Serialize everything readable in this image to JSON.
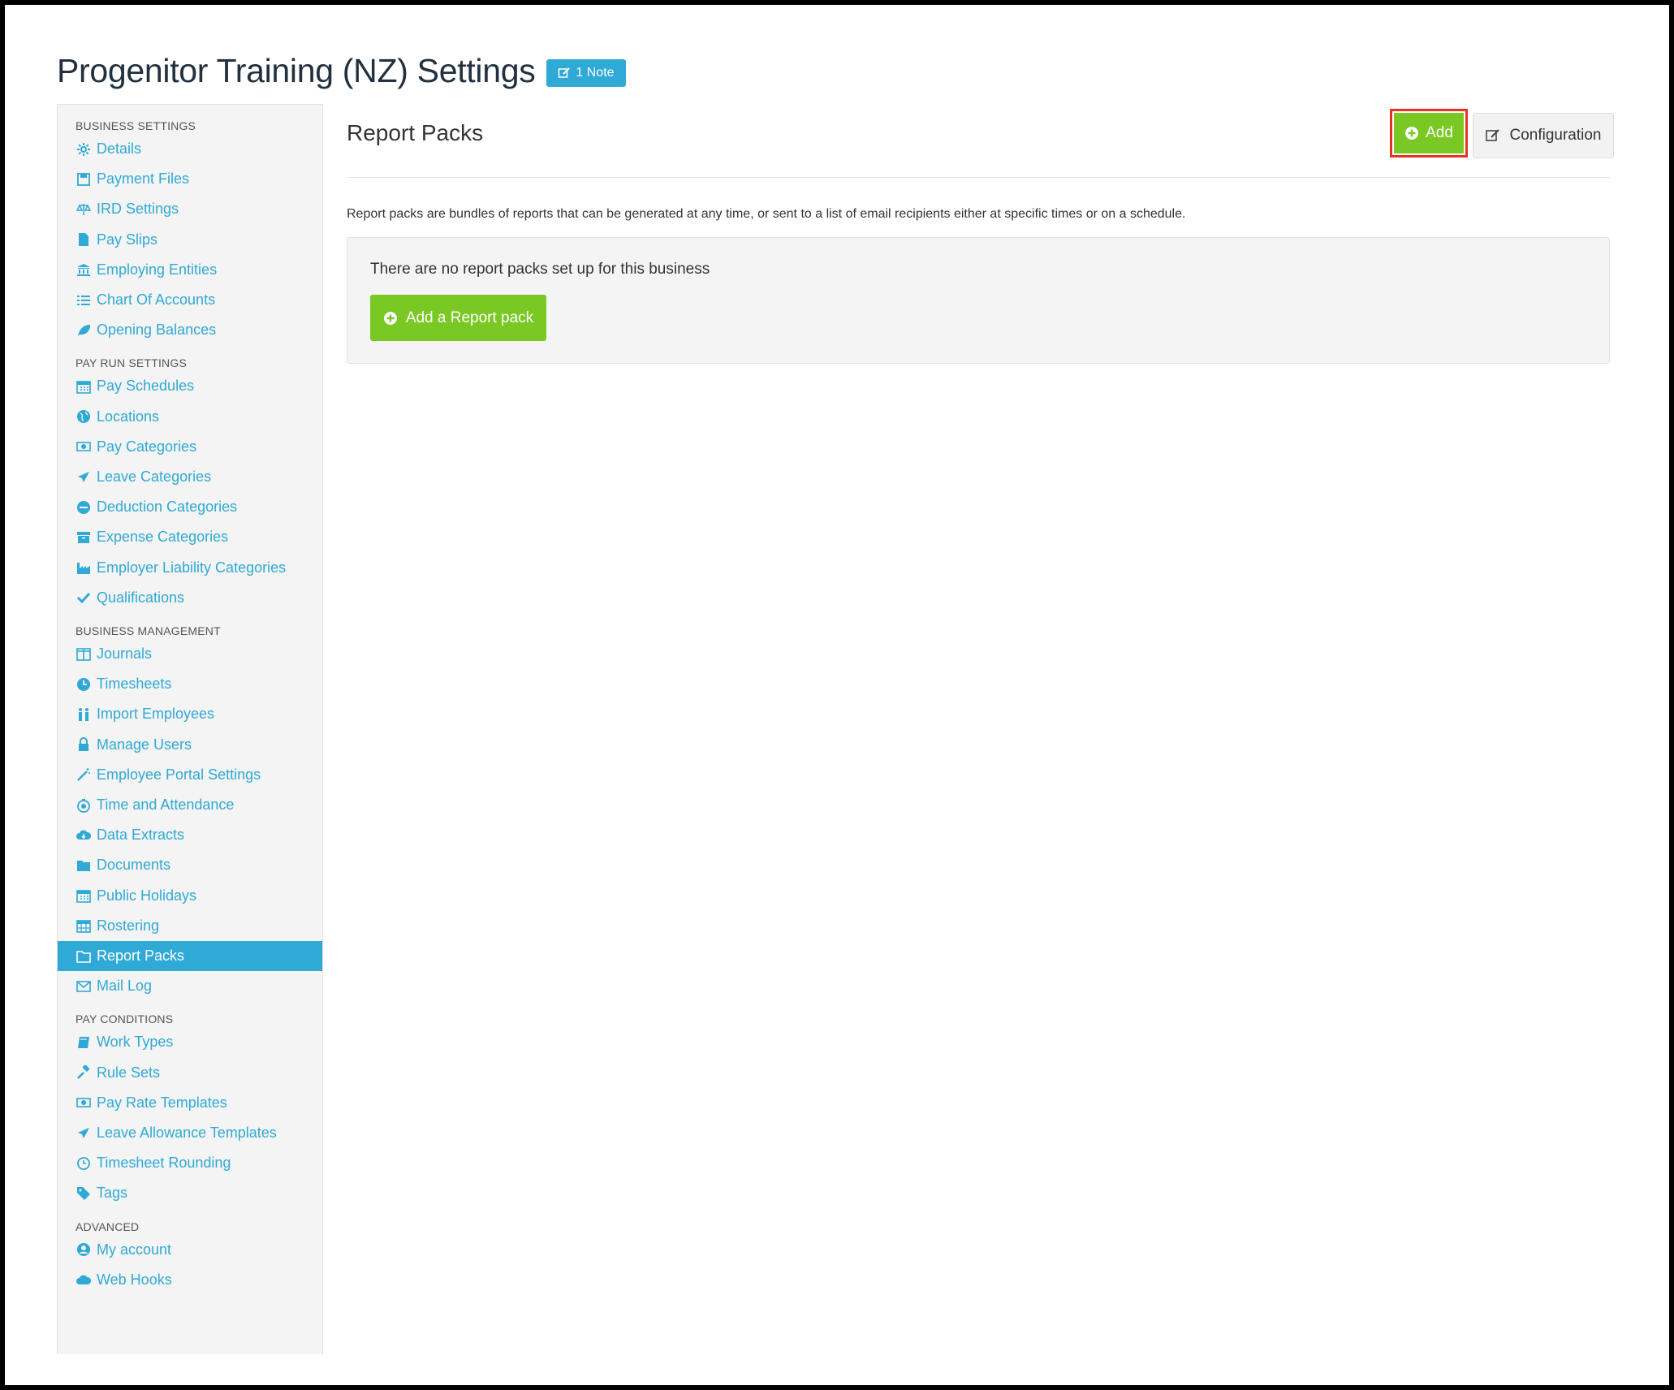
{
  "header": {
    "title": "Progenitor Training (NZ) Settings",
    "note_badge": "1 Note"
  },
  "sidebar": {
    "sections": [
      {
        "title": "BUSINESS SETTINGS",
        "items": [
          {
            "label": "Details",
            "icon": "gear-icon"
          },
          {
            "label": "Payment Files",
            "icon": "floppy-icon"
          },
          {
            "label": "IRD Settings",
            "icon": "scale-icon"
          },
          {
            "label": "Pay Slips",
            "icon": "file-icon"
          },
          {
            "label": "Employing Entities",
            "icon": "bank-icon"
          },
          {
            "label": "Chart Of Accounts",
            "icon": "list-icon"
          },
          {
            "label": "Opening Balances",
            "icon": "leaf-icon"
          }
        ]
      },
      {
        "title": "PAY RUN SETTINGS",
        "items": [
          {
            "label": "Pay Schedules",
            "icon": "calendar-icon"
          },
          {
            "label": "Locations",
            "icon": "globe-icon"
          },
          {
            "label": "Pay Categories",
            "icon": "money-icon"
          },
          {
            "label": "Leave Categories",
            "icon": "plane-icon"
          },
          {
            "label": "Deduction Categories",
            "icon": "minus-circle-icon"
          },
          {
            "label": "Expense Categories",
            "icon": "archive-icon"
          },
          {
            "label": "Employer Liability Categories",
            "icon": "industry-icon"
          },
          {
            "label": "Qualifications",
            "icon": "check-icon"
          }
        ]
      },
      {
        "title": "BUSINESS MANAGEMENT",
        "items": [
          {
            "label": "Journals",
            "icon": "columns-icon"
          },
          {
            "label": "Timesheets",
            "icon": "clock-icon"
          },
          {
            "label": "Import Employees",
            "icon": "users-icon"
          },
          {
            "label": "Manage Users",
            "icon": "lock-icon"
          },
          {
            "label": "Employee Portal Settings",
            "icon": "magic-wand-icon"
          },
          {
            "label": "Time and Attendance",
            "icon": "stopwatch-icon"
          },
          {
            "label": "Data Extracts",
            "icon": "cloud-download-icon"
          },
          {
            "label": "Documents",
            "icon": "folder-icon"
          },
          {
            "label": "Public Holidays",
            "icon": "calendar-icon"
          },
          {
            "label": "Rostering",
            "icon": "calendar-grid-icon"
          },
          {
            "label": "Report Packs",
            "icon": "folder-open-icon",
            "active": true
          },
          {
            "label": "Mail Log",
            "icon": "envelope-icon"
          }
        ]
      },
      {
        "title": "PAY CONDITIONS",
        "items": [
          {
            "label": "Work Types",
            "icon": "book-icon"
          },
          {
            "label": "Rule Sets",
            "icon": "gavel-icon"
          },
          {
            "label": "Pay Rate Templates",
            "icon": "money-icon"
          },
          {
            "label": "Leave Allowance Templates",
            "icon": "plane-icon"
          },
          {
            "label": "Timesheet Rounding",
            "icon": "clock-outline-icon"
          },
          {
            "label": "Tags",
            "icon": "tag-icon"
          }
        ]
      },
      {
        "title": "ADVANCED",
        "items": [
          {
            "label": "My account",
            "icon": "user-circle-icon"
          },
          {
            "label": "Web Hooks",
            "icon": "cloud-icon"
          }
        ]
      }
    ]
  },
  "main": {
    "title": "Report Packs",
    "add_label": "Add",
    "configuration_label": "Configuration",
    "description": "Report packs are bundles of reports that can be generated at any time, or sent to a list of email recipients either at specific times or on a schedule.",
    "empty_message": "There are no report packs set up for this business",
    "add_pack_label": "Add a Report pack"
  },
  "colors": {
    "accent_blue": "#2fa9d6",
    "accent_green": "#7ac824",
    "highlight_red": "#e53222"
  }
}
